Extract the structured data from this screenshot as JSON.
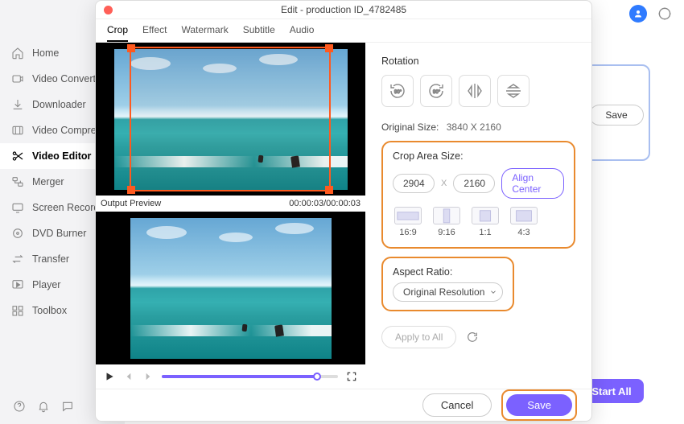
{
  "window": {
    "title": "Edit - production ID_4782485"
  },
  "sidebar": {
    "items": [
      {
        "label": "Home"
      },
      {
        "label": "Video Converter"
      },
      {
        "label": "Downloader"
      },
      {
        "label": "Video Compressor"
      },
      {
        "label": "Video Editor"
      },
      {
        "label": "Merger"
      },
      {
        "label": "Screen Recorder"
      },
      {
        "label": "DVD Burner"
      },
      {
        "label": "Transfer"
      },
      {
        "label": "Player"
      },
      {
        "label": "Toolbox"
      }
    ],
    "active_index": 4
  },
  "main_shell": {
    "save_label": "Save",
    "start_all_label": "Start All"
  },
  "tabs": {
    "items": [
      "Crop",
      "Effect",
      "Watermark",
      "Subtitle",
      "Audio"
    ],
    "active_index": 0
  },
  "preview": {
    "output_label": "Output Preview",
    "time_stamp": "00:00:03/00:00:03"
  },
  "rotation": {
    "title": "Rotation"
  },
  "original_size": {
    "label": "Original Size:",
    "value": "3840 X 2160"
  },
  "crop_area": {
    "title": "Crop Area Size:",
    "width": "2904",
    "sep": "X",
    "height": "2160",
    "align_label": "Align Center",
    "ratios": [
      "16:9",
      "9:16",
      "1:1",
      "4:3"
    ]
  },
  "aspect": {
    "title": "Aspect Ratio:",
    "selected": "Original Resolution"
  },
  "apply": {
    "label": "Apply to All"
  },
  "footer": {
    "cancel": "Cancel",
    "save": "Save"
  }
}
